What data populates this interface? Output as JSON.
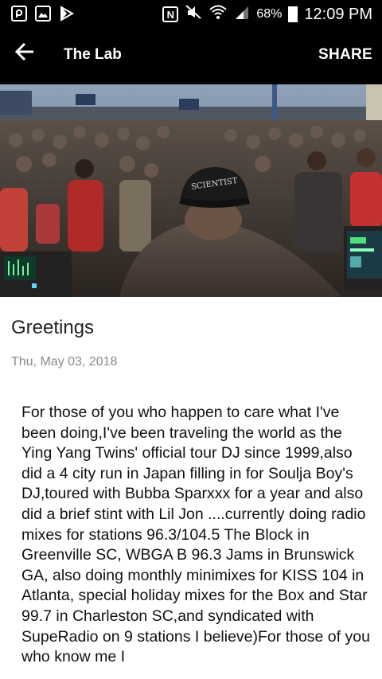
{
  "status_bar": {
    "battery_pct": "68%",
    "time": "12:09 PM",
    "icons": [
      "flipboard-icon",
      "gallery-icon",
      "play-store-icon",
      "nfc-icon",
      "mute-icon",
      "wifi-icon",
      "signal-icon",
      "battery-icon"
    ]
  },
  "app_bar": {
    "title": "The Lab",
    "share_label": "SHARE",
    "back_icon": "arrow-left-icon"
  },
  "article": {
    "title": "Greetings",
    "date": "Thu, May 03, 2018",
    "body": "For those of you who happen to care what I've been doing,I've been traveling the world as the Ying Yang Twins' official tour DJ since 1999,also did a 4 city run in Japan filling in for Soulja Boy's DJ,toured with Bubba Sparxxx for a year and also did a brief stint with Lil Jon ....currently doing radio mixes for stations 96.3/104.5 The Block in Greenville SC, WBGA B 96.3 Jams in Brunswick GA, also doing monthly minimixes for KISS 104 in Atlanta, special holiday mixes for the Box and Star 99.7 in Charleston SC,and syndicated with SupeRadio on 9 stations I believe)For those of you who know me I"
  },
  "hero": {
    "cap_text": "SCIENTIST"
  },
  "colors": {
    "bar_bg": "#000000",
    "bar_fg": "#ffffff",
    "date_gray": "#8a8a8a"
  }
}
